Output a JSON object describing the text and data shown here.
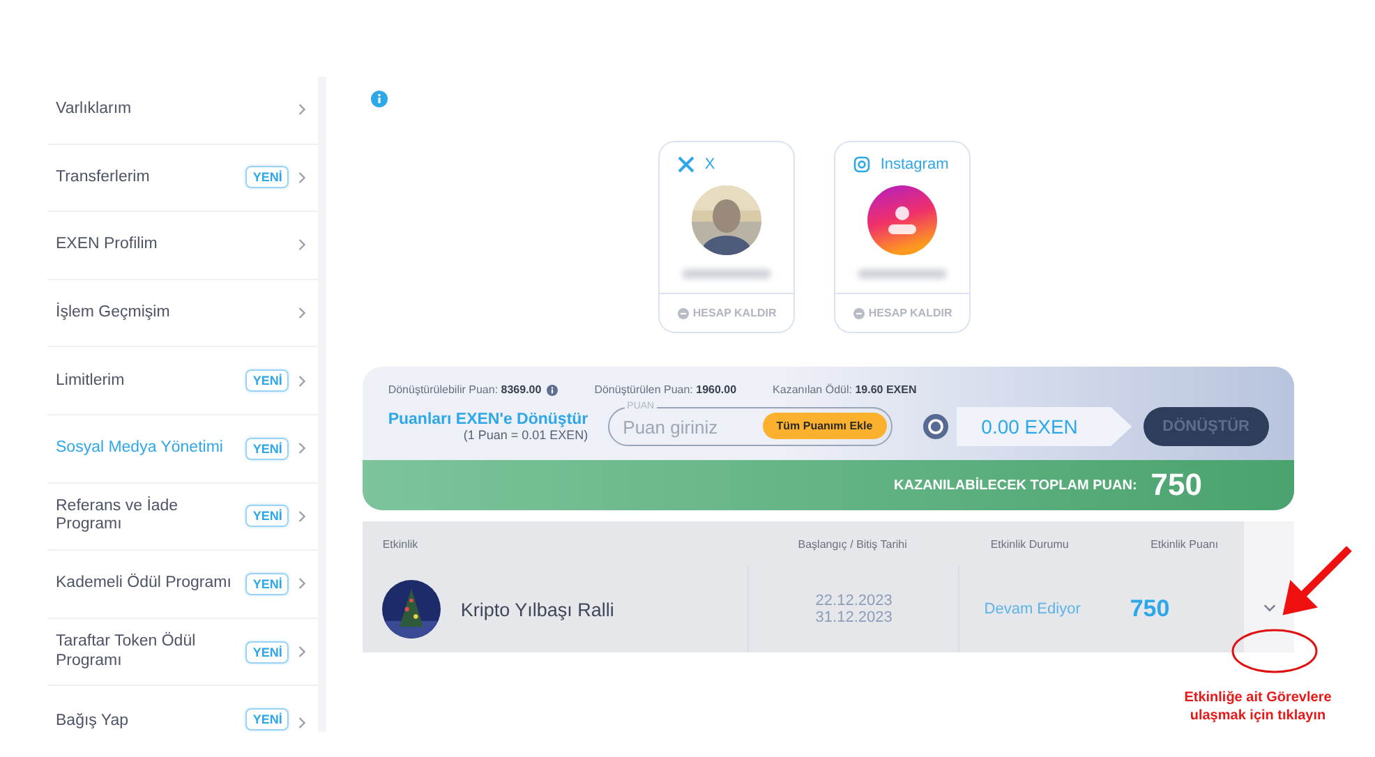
{
  "sidebar": {
    "items": [
      {
        "label": "Varlıklarım",
        "selected": false
      },
      {
        "label": "Transferlerim",
        "badge": "YENİ",
        "selected": false
      },
      {
        "label": "EXEN Profilim",
        "selected": false
      },
      {
        "label": "İşlem Geçmişim",
        "selected": false
      },
      {
        "label": "Limitlerim",
        "badge": "YENİ",
        "selected": false
      },
      {
        "label": "Sosyal Medya Yönetimi",
        "badge": "YENİ",
        "selected": true
      },
      {
        "label": "Referans ve İade Programı",
        "badge": "YENİ",
        "selected": false
      },
      {
        "label": "Kademeli Ödül Programı",
        "badge": "YENİ",
        "selected": false
      },
      {
        "label": "Taraftar Token Ödül Programı",
        "badge": "YENİ",
        "selected": false
      },
      {
        "label": "Bağış Yap",
        "badge": "YENİ",
        "selected": false
      }
    ]
  },
  "social_accounts": [
    {
      "kind": "x",
      "platform": "X",
      "action": "HESAP KALDIR"
    },
    {
      "kind": "instagram",
      "platform": "Instagram",
      "action": "HESAP KALDIR"
    }
  ],
  "conversion": {
    "stats": [
      {
        "label": "Dönüştürülebilir Puan:",
        "value": "8369.00",
        "info": true
      },
      {
        "label": "Dönüştürülen Puan:",
        "value": "1960.00",
        "info": false
      },
      {
        "label": "Kazanılan Ödül:",
        "value": "19.60 EXEN",
        "info": false
      }
    ],
    "title": "Puanları EXEN'e Dönüştür",
    "rate": "(1 Puan = 0.01 EXEN)",
    "input_label": "PUAN",
    "placeholder": "Puan giriniz",
    "add_all_button": "Tüm Puanımı Ekle",
    "result": "0.00 EXEN",
    "convert_button": {
      "label": "DÖNÜŞTÜR",
      "disabled": true
    }
  },
  "total": {
    "label": "KAZANILABİLECEK TOPLAM PUAN:",
    "value": "750"
  },
  "table": {
    "columns": [
      "Etkinlik",
      "Başlangıç / Bitiş Tarihi",
      "Etkinlik Durumu",
      "Etkinlik Puanı"
    ],
    "rows": [
      {
        "name": "Kripto Yılbaşı Ralli",
        "start": "22.12.2023",
        "end": "31.12.2023",
        "status": "Devam Ediyor",
        "points": "750",
        "expanded": false
      }
    ]
  },
  "annotation": {
    "text": "Etkinliğe ait Görevlere ulaşmak için tıklayın"
  }
}
